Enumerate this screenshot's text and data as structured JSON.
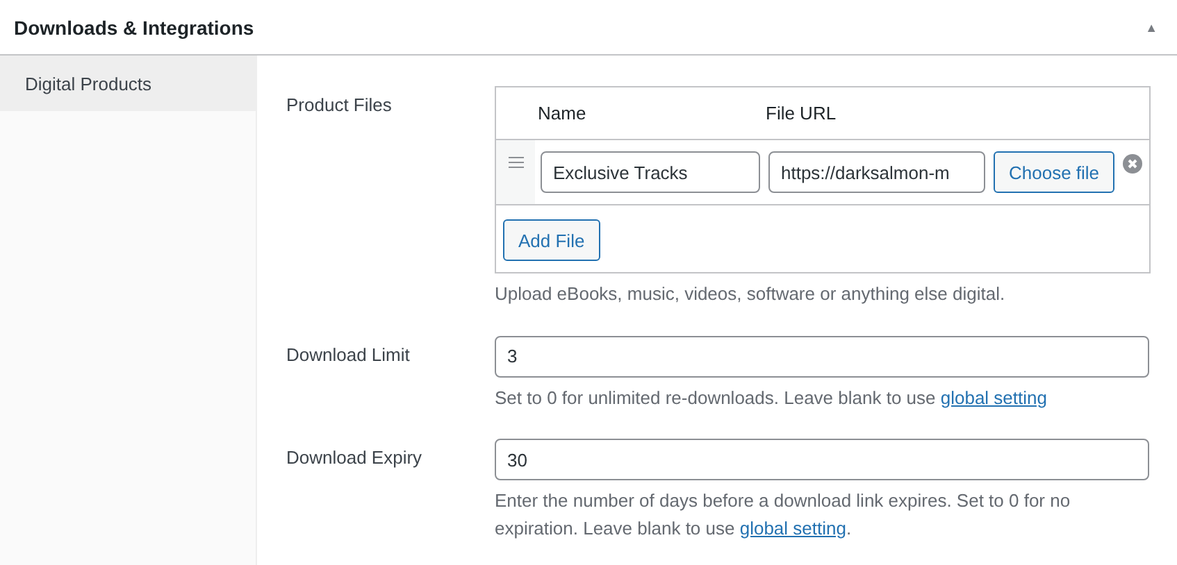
{
  "panel": {
    "title": "Downloads & Integrations",
    "collapse_glyph": "▲",
    "expanded": true
  },
  "sidebar": {
    "items": [
      {
        "label": "Digital Products",
        "selected": true
      }
    ]
  },
  "product_files": {
    "label": "Product Files",
    "columns": [
      "Name",
      "File URL"
    ],
    "rows": [
      {
        "name": "Exclusive Tracks",
        "url": "https://darksalmon-m",
        "button": "Choose file"
      }
    ],
    "add_button": "Add File",
    "help": "Upload eBooks, music, videos, software or anything else digital."
  },
  "fields": [
    {
      "label": "Download Limit",
      "value": "3",
      "help_before": "Set to 0 for unlimited re-downloads. Leave blank to use ",
      "link": "global setting"
    },
    {
      "label": "Download Expiry",
      "value": "30",
      "help_before": "Enter the number of days before a download link expires. Set to 0 for no expiration. Leave blank to use ",
      "link": "global setting",
      "help_after": "."
    }
  ]
}
